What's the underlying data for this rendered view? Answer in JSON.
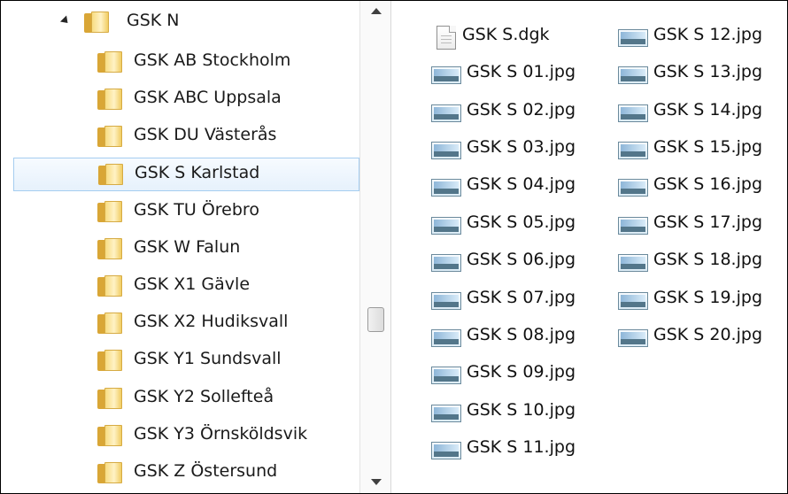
{
  "tree": {
    "parent": {
      "label": "GSK N",
      "icon": "folder-icon",
      "expander": "collapse-triangle-icon"
    },
    "children": [
      {
        "label": "GSK AB Stockholm"
      },
      {
        "label": "GSK ABC Uppsala"
      },
      {
        "label": "GSK DU Västerås"
      },
      {
        "label": "GSK S Karlstad",
        "selected": true
      },
      {
        "label": "GSK TU Örebro"
      },
      {
        "label": "GSK W Falun"
      },
      {
        "label": "GSK X1 Gävle"
      },
      {
        "label": "GSK X2 Hudiksvall"
      },
      {
        "label": "GSK Y1 Sundsvall"
      },
      {
        "label": "GSK Y2 Sollefteå"
      },
      {
        "label": "GSK Y3 Örnsköldsvik"
      },
      {
        "label": "GSK Z Östersund"
      }
    ]
  },
  "files": {
    "column1": [
      {
        "name": "GSK S.dgk",
        "icon": "document-icon"
      },
      {
        "name": "GSK S 01.jpg",
        "icon": "image-file-icon"
      },
      {
        "name": "GSK S 02.jpg",
        "icon": "image-file-icon"
      },
      {
        "name": "GSK S 03.jpg",
        "icon": "image-file-icon"
      },
      {
        "name": "GSK S 04.jpg",
        "icon": "image-file-icon"
      },
      {
        "name": "GSK S 05.jpg",
        "icon": "image-file-icon"
      },
      {
        "name": "GSK S 06.jpg",
        "icon": "image-file-icon"
      },
      {
        "name": "GSK S 07.jpg",
        "icon": "image-file-icon"
      },
      {
        "name": "GSK S 08.jpg",
        "icon": "image-file-icon"
      },
      {
        "name": "GSK S 09.jpg",
        "icon": "image-file-icon"
      },
      {
        "name": "GSK S 10.jpg",
        "icon": "image-file-icon"
      },
      {
        "name": "GSK S 11.jpg",
        "icon": "image-file-icon"
      }
    ],
    "column2": [
      {
        "name": "GSK S 12.jpg",
        "icon": "image-file-icon"
      },
      {
        "name": "GSK S 13.jpg",
        "icon": "image-file-icon"
      },
      {
        "name": "GSK S 14.jpg",
        "icon": "image-file-icon"
      },
      {
        "name": "GSK S 15.jpg",
        "icon": "image-file-icon"
      },
      {
        "name": "GSK S 16.jpg",
        "icon": "image-file-icon"
      },
      {
        "name": "GSK S 17.jpg",
        "icon": "image-file-icon"
      },
      {
        "name": "GSK S 18.jpg",
        "icon": "image-file-icon"
      },
      {
        "name": "GSK S 19.jpg",
        "icon": "image-file-icon"
      },
      {
        "name": "GSK S 20.jpg",
        "icon": "image-file-icon"
      }
    ]
  },
  "colors": {
    "selection_fill": "#e6f1fc",
    "selection_border": "#a5cdf0",
    "folder": "#f1cd63"
  }
}
